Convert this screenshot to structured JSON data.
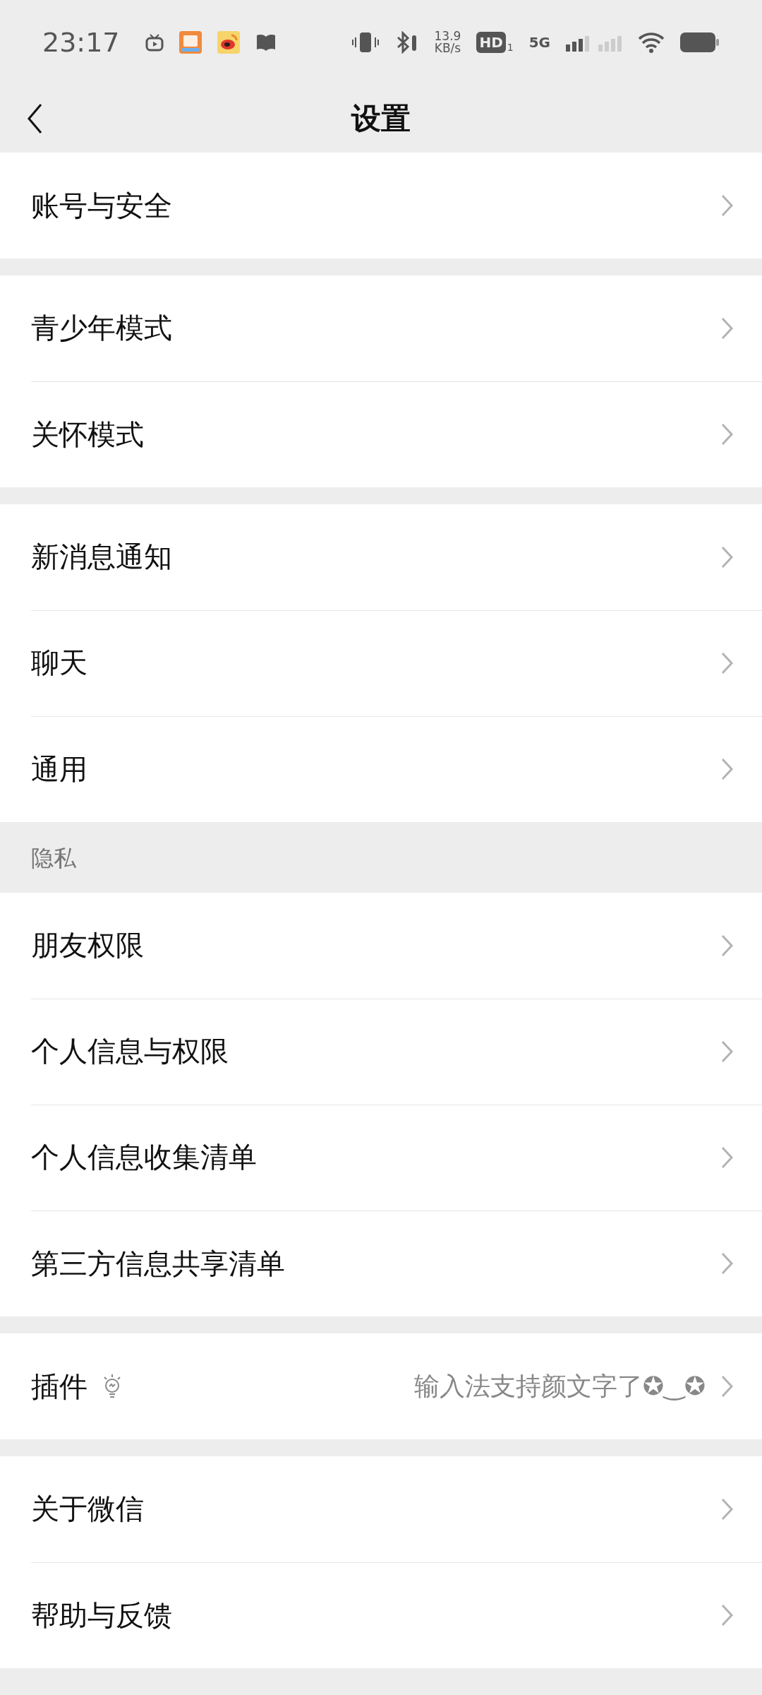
{
  "status_bar": {
    "time": "23:17",
    "speed_value": "13.9",
    "speed_unit": "KB/s",
    "hd_label": "HD",
    "hd_sim": "1",
    "network": "5G"
  },
  "header": {
    "title": "设置"
  },
  "groups": [
    {
      "items": [
        {
          "kind": "link",
          "label": "账号与安全"
        }
      ]
    },
    {
      "items": [
        {
          "kind": "link",
          "label": "青少年模式"
        },
        {
          "kind": "link",
          "label": "关怀模式"
        }
      ]
    },
    {
      "items": [
        {
          "kind": "link",
          "label": "新消息通知"
        },
        {
          "kind": "link",
          "label": "聊天"
        },
        {
          "kind": "link",
          "label": "通用"
        }
      ]
    },
    {
      "title": "隐私",
      "items": [
        {
          "kind": "link",
          "label": "朋友权限"
        },
        {
          "kind": "link",
          "label": "个人信息与权限"
        },
        {
          "kind": "link",
          "label": "个人信息收集清单"
        },
        {
          "kind": "link",
          "label": "第三方信息共享清单"
        }
      ]
    },
    {
      "items": [
        {
          "kind": "plugin",
          "label": "插件",
          "value": "输入法支持颜文字了✪‿✪"
        }
      ]
    },
    {
      "items": [
        {
          "kind": "link",
          "label": "关于微信"
        },
        {
          "kind": "link",
          "label": "帮助与反馈"
        }
      ]
    }
  ]
}
